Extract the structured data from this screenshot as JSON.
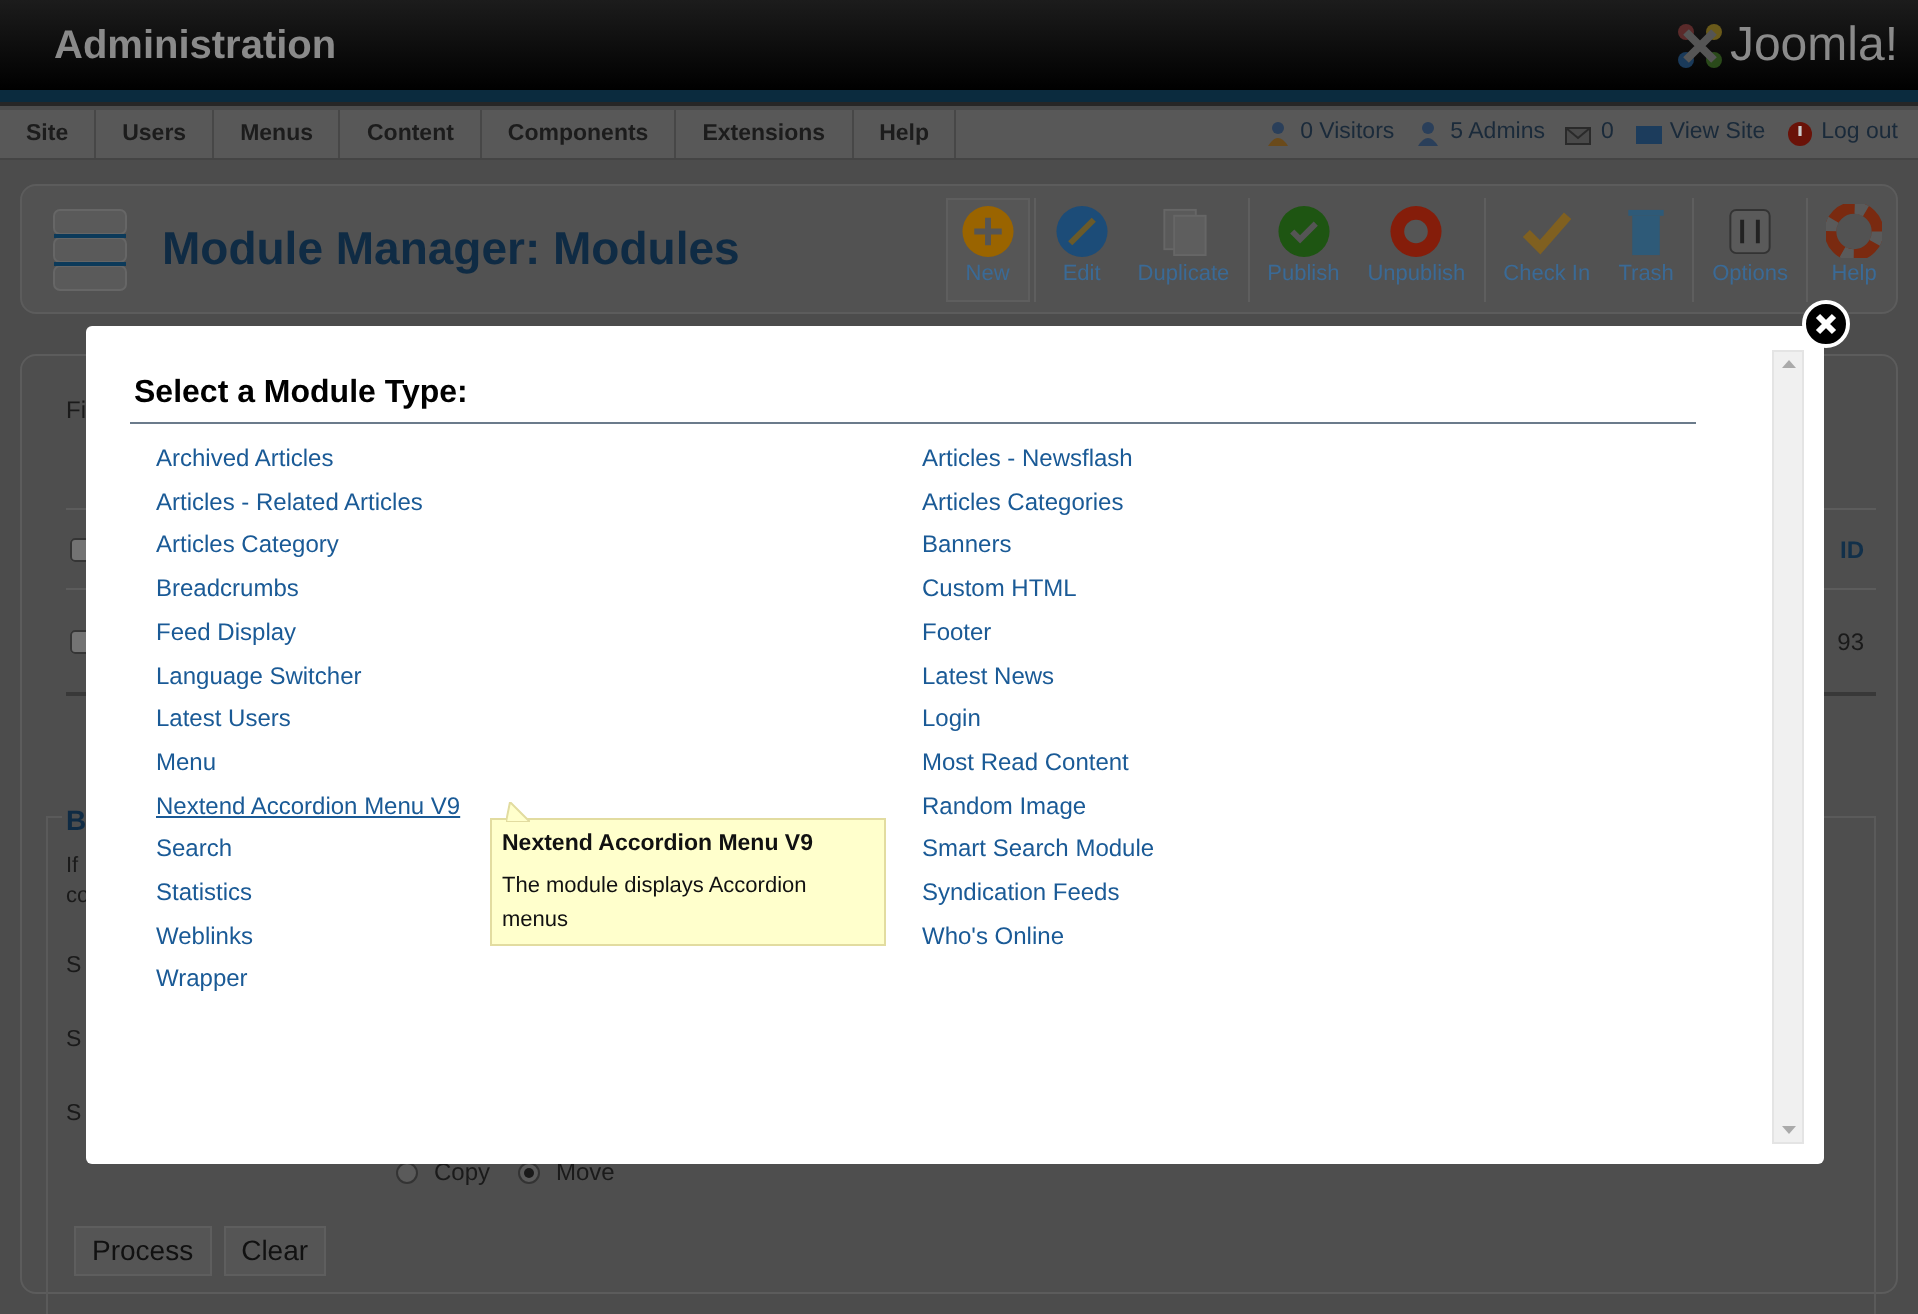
{
  "header": {
    "title": "Administration",
    "logo_text": "Joomla!"
  },
  "menu": [
    "Site",
    "Users",
    "Menus",
    "Content",
    "Components",
    "Extensions",
    "Help"
  ],
  "status": [
    {
      "kind": "visitors",
      "label": "0 Visitors"
    },
    {
      "kind": "admins",
      "label": "5 Admins"
    },
    {
      "kind": "messages",
      "label": "0"
    },
    {
      "kind": "view-site",
      "label": "View Site"
    },
    {
      "kind": "logout",
      "label": "Log out"
    }
  ],
  "toolbar": {
    "title": "Module Manager: Modules",
    "buttons": [
      {
        "kind": "new",
        "label": "New",
        "highlighted": true
      },
      {
        "kind": "edit",
        "label": "Edit",
        "highlighted": false
      },
      {
        "kind": "duplicate",
        "label": "Duplicate",
        "highlighted": false
      },
      {
        "kind": "publish",
        "label": "Publish",
        "highlighted": false
      },
      {
        "kind": "unpublish",
        "label": "Unpublish",
        "highlighted": false
      },
      {
        "kind": "checkin",
        "label": "Check In",
        "highlighted": false
      },
      {
        "kind": "trash",
        "label": "Trash",
        "highlighted": false
      },
      {
        "kind": "options",
        "label": "Options",
        "highlighted": false
      },
      {
        "kind": "help",
        "label": "Help",
        "highlighted": false
      }
    ]
  },
  "background": {
    "filter_label": "Fi",
    "header_checkbox_checked": false,
    "id_header": "ID",
    "row_checkbox_checked": false,
    "row_id": "93",
    "fieldset_legend": "B",
    "intro_lines": [
      "If",
      "co"
    ],
    "field_labels": [
      "S",
      "S",
      "S"
    ],
    "radios": [
      {
        "label": "Copy",
        "selected": false
      },
      {
        "label": "Move",
        "selected": true
      }
    ],
    "buttons": [
      "Process",
      "Clear"
    ]
  },
  "modal": {
    "title": "Select a Module Type:",
    "columns": [
      [
        {
          "label": "Archived Articles",
          "hovered": false
        },
        {
          "label": "Articles - Related Articles",
          "hovered": false
        },
        {
          "label": "Articles Category",
          "hovered": false
        },
        {
          "label": "Breadcrumbs",
          "hovered": false
        },
        {
          "label": "Feed Display",
          "hovered": false
        },
        {
          "label": "Language Switcher",
          "hovered": false
        },
        {
          "label": "Latest Users",
          "hovered": false
        },
        {
          "label": "Menu",
          "hovered": false
        },
        {
          "label": "Nextend Accordion Menu V9",
          "hovered": true
        },
        {
          "label": "Search",
          "hovered": false
        },
        {
          "label": "Statistics",
          "hovered": false
        },
        {
          "label": "Weblinks",
          "hovered": false
        },
        {
          "label": "Wrapper",
          "hovered": false
        }
      ],
      [
        {
          "label": "Articles - Newsflash",
          "hovered": false
        },
        {
          "label": "Articles Categories",
          "hovered": false
        },
        {
          "label": "Banners",
          "hovered": false
        },
        {
          "label": "Custom HTML",
          "hovered": false
        },
        {
          "label": "Footer",
          "hovered": false
        },
        {
          "label": "Latest News",
          "hovered": false
        },
        {
          "label": "Login",
          "hovered": false
        },
        {
          "label": "Most Read Content",
          "hovered": false
        },
        {
          "label": "Random Image",
          "hovered": false
        },
        {
          "label": "Smart Search Module",
          "hovered": false
        },
        {
          "label": "Syndication Feeds",
          "hovered": false
        },
        {
          "label": "Who's Online",
          "hovered": false
        }
      ]
    ],
    "tooltip": {
      "title": "Nextend Accordion Menu V9",
      "text": "The module displays Accordion menus"
    }
  }
}
